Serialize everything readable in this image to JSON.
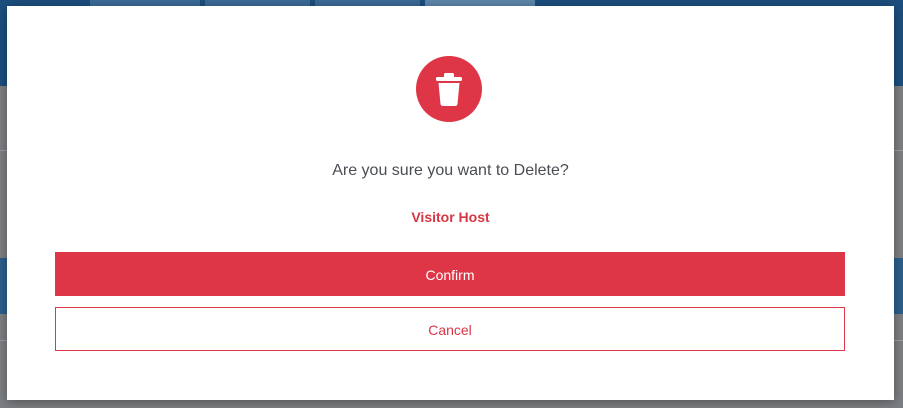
{
  "dialog": {
    "icon": "trash-icon",
    "question": "Are you sure you want to Delete?",
    "item_name": "Visitor Host",
    "confirm_label": "Confirm",
    "cancel_label": "Cancel"
  },
  "colors": {
    "danger": "#de3646",
    "text": "#4a4d55",
    "backdrop_brand": "#1c4e7e"
  }
}
